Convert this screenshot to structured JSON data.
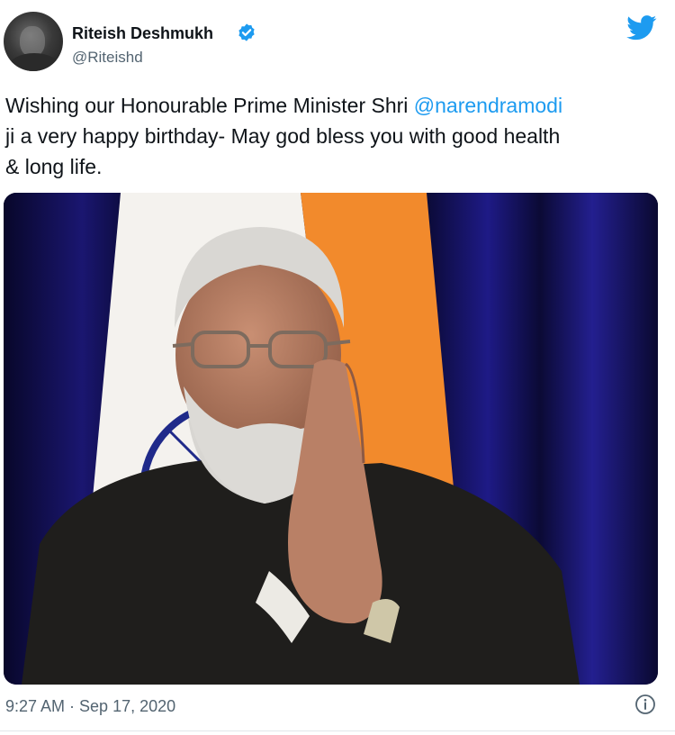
{
  "author": {
    "name": "Riteish Deshmukh",
    "handle": "@Riteishd",
    "verified": true
  },
  "tweet": {
    "line1_pre": "Wishing our Honourable Prime Minister Shri ",
    "mention": "@narendramodi",
    "line2": "ji a very happy birthday- May god bless you with good health",
    "line3": "& long life."
  },
  "meta": {
    "timestamp": "9:27 AM · Sep 17, 2020"
  },
  "icons": {
    "platform": "twitter-bird-icon",
    "verified": "verified-badge-icon",
    "info": "info-icon"
  },
  "colors": {
    "accent": "#1d9bf0",
    "text": "#0f1419",
    "secondary_text": "#536471"
  }
}
